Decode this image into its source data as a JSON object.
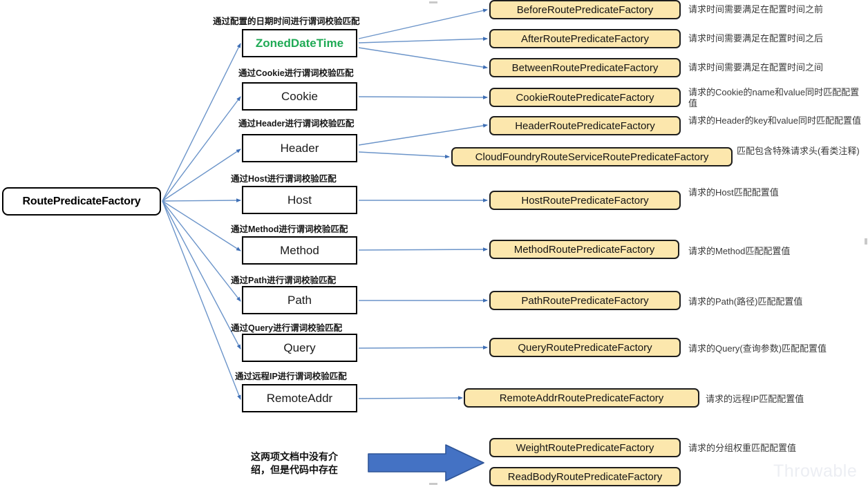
{
  "diagram": {
    "title": "RoutePredicateFactory",
    "watermark": "Throwable",
    "colors": {
      "pill_fill": "#fce7ad",
      "pill_border": "#1d1d1d",
      "node_border": "#000000",
      "connector": "#6b94c9",
      "accent_green": "#1faa55",
      "block_arrow": "#4472c4",
      "block_arrow_border": "#2f5597"
    },
    "root": {
      "label": "RoutePredicateFactory"
    },
    "categories": [
      {
        "caption": "通过配置的日期时间进行谓词校验匹配",
        "label": "ZonedDateTime",
        "accent": true
      },
      {
        "caption": "通过Cookie进行谓词校验匹配",
        "label": "Cookie",
        "accent": false
      },
      {
        "caption": "通过Header进行谓词校验匹配",
        "label": "Header",
        "accent": false
      },
      {
        "caption": "通过Host进行谓词校验匹配",
        "label": "Host",
        "accent": false
      },
      {
        "caption": "通过Method进行谓词校验匹配",
        "label": "Method",
        "accent": false
      },
      {
        "caption": "通过Path进行谓词校验匹配",
        "label": "Path",
        "accent": false
      },
      {
        "caption": "通过Query进行谓词校验匹配",
        "label": "Query",
        "accent": false
      },
      {
        "caption": "通过远程IP进行谓词校验匹配",
        "label": "RemoteAddr",
        "accent": false
      }
    ],
    "factories": [
      {
        "label": "BeforeRoutePredicateFactory",
        "desc": "请求时间需要满足在配置时间之前"
      },
      {
        "label": "AfterRoutePredicateFactory",
        "desc": "请求时间需要满足在配置时间之后"
      },
      {
        "label": "BetweenRoutePredicateFactory",
        "desc": "请求时间需要满足在配置时间之间"
      },
      {
        "label": "CookieRoutePredicateFactory",
        "desc": "请求的Cookie的name和value同时匹配配置值"
      },
      {
        "label": "HeaderRoutePredicateFactory",
        "desc": "请求的Header的key和value同时匹配配置值"
      },
      {
        "label": "CloudFoundryRouteServiceRoutePredicateFactory",
        "desc": "匹配包含特殊请求头(看类注释)"
      },
      {
        "label": "HostRoutePredicateFactory",
        "desc": "请求的Host匹配配置值"
      },
      {
        "label": "MethodRoutePredicateFactory",
        "desc": "请求的Method匹配配置值"
      },
      {
        "label": "PathRoutePredicateFactory",
        "desc": "请求的Path(路径)匹配配置值"
      },
      {
        "label": "QueryRoutePredicateFactory",
        "desc": "请求的Query(查询参数)匹配配置值"
      },
      {
        "label": "RemoteAddrRoutePredicateFactory",
        "desc": "请求的远程IP匹配配置值"
      },
      {
        "label": "WeightRoutePredicateFactory",
        "desc": "请求的分组权重匹配配置值"
      },
      {
        "label": "ReadBodyRoutePredicateFactory",
        "desc": ""
      }
    ],
    "note": {
      "line1": "这两项文档中没有介",
      "line2": "绍，但是代码中存在"
    }
  }
}
